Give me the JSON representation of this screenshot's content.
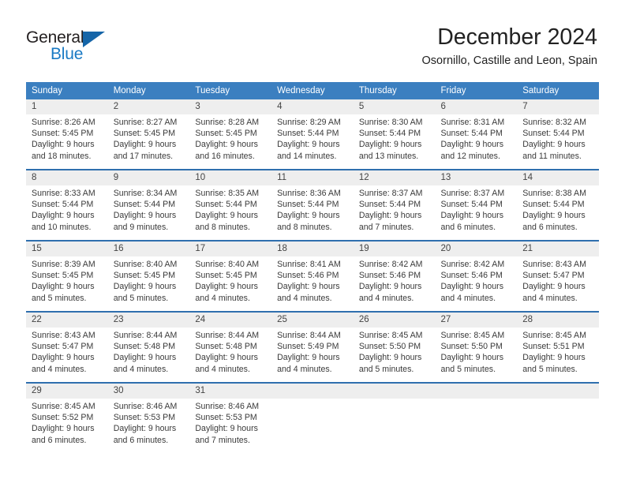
{
  "logo": {
    "word_one": "General",
    "word_two": "Blue",
    "triangle_color": "#1565a8",
    "blue_color": "#1a7ac4"
  },
  "header": {
    "month_title": "December 2024",
    "location": "Osornillo, Castille and Leon, Spain"
  },
  "calendar": {
    "header_color": "#3b7fc0",
    "row_divider_color": "#2f6fae",
    "daynum_band_color": "#eeeeee",
    "weekday_headers": [
      "Sunday",
      "Monday",
      "Tuesday",
      "Wednesday",
      "Thursday",
      "Friday",
      "Saturday"
    ],
    "weeks": [
      [
        {
          "day": "1",
          "sunrise": "Sunrise: 8:26 AM",
          "sunset": "Sunset: 5:45 PM",
          "daylight_line1": "Daylight: 9 hours",
          "daylight_line2": "and 18 minutes."
        },
        {
          "day": "2",
          "sunrise": "Sunrise: 8:27 AM",
          "sunset": "Sunset: 5:45 PM",
          "daylight_line1": "Daylight: 9 hours",
          "daylight_line2": "and 17 minutes."
        },
        {
          "day": "3",
          "sunrise": "Sunrise: 8:28 AM",
          "sunset": "Sunset: 5:45 PM",
          "daylight_line1": "Daylight: 9 hours",
          "daylight_line2": "and 16 minutes."
        },
        {
          "day": "4",
          "sunrise": "Sunrise: 8:29 AM",
          "sunset": "Sunset: 5:44 PM",
          "daylight_line1": "Daylight: 9 hours",
          "daylight_line2": "and 14 minutes."
        },
        {
          "day": "5",
          "sunrise": "Sunrise: 8:30 AM",
          "sunset": "Sunset: 5:44 PM",
          "daylight_line1": "Daylight: 9 hours",
          "daylight_line2": "and 13 minutes."
        },
        {
          "day": "6",
          "sunrise": "Sunrise: 8:31 AM",
          "sunset": "Sunset: 5:44 PM",
          "daylight_line1": "Daylight: 9 hours",
          "daylight_line2": "and 12 minutes."
        },
        {
          "day": "7",
          "sunrise": "Sunrise: 8:32 AM",
          "sunset": "Sunset: 5:44 PM",
          "daylight_line1": "Daylight: 9 hours",
          "daylight_line2": "and 11 minutes."
        }
      ],
      [
        {
          "day": "8",
          "sunrise": "Sunrise: 8:33 AM",
          "sunset": "Sunset: 5:44 PM",
          "daylight_line1": "Daylight: 9 hours",
          "daylight_line2": "and 10 minutes."
        },
        {
          "day": "9",
          "sunrise": "Sunrise: 8:34 AM",
          "sunset": "Sunset: 5:44 PM",
          "daylight_line1": "Daylight: 9 hours",
          "daylight_line2": "and 9 minutes."
        },
        {
          "day": "10",
          "sunrise": "Sunrise: 8:35 AM",
          "sunset": "Sunset: 5:44 PM",
          "daylight_line1": "Daylight: 9 hours",
          "daylight_line2": "and 8 minutes."
        },
        {
          "day": "11",
          "sunrise": "Sunrise: 8:36 AM",
          "sunset": "Sunset: 5:44 PM",
          "daylight_line1": "Daylight: 9 hours",
          "daylight_line2": "and 8 minutes."
        },
        {
          "day": "12",
          "sunrise": "Sunrise: 8:37 AM",
          "sunset": "Sunset: 5:44 PM",
          "daylight_line1": "Daylight: 9 hours",
          "daylight_line2": "and 7 minutes."
        },
        {
          "day": "13",
          "sunrise": "Sunrise: 8:37 AM",
          "sunset": "Sunset: 5:44 PM",
          "daylight_line1": "Daylight: 9 hours",
          "daylight_line2": "and 6 minutes."
        },
        {
          "day": "14",
          "sunrise": "Sunrise: 8:38 AM",
          "sunset": "Sunset: 5:44 PM",
          "daylight_line1": "Daylight: 9 hours",
          "daylight_line2": "and 6 minutes."
        }
      ],
      [
        {
          "day": "15",
          "sunrise": "Sunrise: 8:39 AM",
          "sunset": "Sunset: 5:45 PM",
          "daylight_line1": "Daylight: 9 hours",
          "daylight_line2": "and 5 minutes."
        },
        {
          "day": "16",
          "sunrise": "Sunrise: 8:40 AM",
          "sunset": "Sunset: 5:45 PM",
          "daylight_line1": "Daylight: 9 hours",
          "daylight_line2": "and 5 minutes."
        },
        {
          "day": "17",
          "sunrise": "Sunrise: 8:40 AM",
          "sunset": "Sunset: 5:45 PM",
          "daylight_line1": "Daylight: 9 hours",
          "daylight_line2": "and 4 minutes."
        },
        {
          "day": "18",
          "sunrise": "Sunrise: 8:41 AM",
          "sunset": "Sunset: 5:46 PM",
          "daylight_line1": "Daylight: 9 hours",
          "daylight_line2": "and 4 minutes."
        },
        {
          "day": "19",
          "sunrise": "Sunrise: 8:42 AM",
          "sunset": "Sunset: 5:46 PM",
          "daylight_line1": "Daylight: 9 hours",
          "daylight_line2": "and 4 minutes."
        },
        {
          "day": "20",
          "sunrise": "Sunrise: 8:42 AM",
          "sunset": "Sunset: 5:46 PM",
          "daylight_line1": "Daylight: 9 hours",
          "daylight_line2": "and 4 minutes."
        },
        {
          "day": "21",
          "sunrise": "Sunrise: 8:43 AM",
          "sunset": "Sunset: 5:47 PM",
          "daylight_line1": "Daylight: 9 hours",
          "daylight_line2": "and 4 minutes."
        }
      ],
      [
        {
          "day": "22",
          "sunrise": "Sunrise: 8:43 AM",
          "sunset": "Sunset: 5:47 PM",
          "daylight_line1": "Daylight: 9 hours",
          "daylight_line2": "and 4 minutes."
        },
        {
          "day": "23",
          "sunrise": "Sunrise: 8:44 AM",
          "sunset": "Sunset: 5:48 PM",
          "daylight_line1": "Daylight: 9 hours",
          "daylight_line2": "and 4 minutes."
        },
        {
          "day": "24",
          "sunrise": "Sunrise: 8:44 AM",
          "sunset": "Sunset: 5:48 PM",
          "daylight_line1": "Daylight: 9 hours",
          "daylight_line2": "and 4 minutes."
        },
        {
          "day": "25",
          "sunrise": "Sunrise: 8:44 AM",
          "sunset": "Sunset: 5:49 PM",
          "daylight_line1": "Daylight: 9 hours",
          "daylight_line2": "and 4 minutes."
        },
        {
          "day": "26",
          "sunrise": "Sunrise: 8:45 AM",
          "sunset": "Sunset: 5:50 PM",
          "daylight_line1": "Daylight: 9 hours",
          "daylight_line2": "and 5 minutes."
        },
        {
          "day": "27",
          "sunrise": "Sunrise: 8:45 AM",
          "sunset": "Sunset: 5:50 PM",
          "daylight_line1": "Daylight: 9 hours",
          "daylight_line2": "and 5 minutes."
        },
        {
          "day": "28",
          "sunrise": "Sunrise: 8:45 AM",
          "sunset": "Sunset: 5:51 PM",
          "daylight_line1": "Daylight: 9 hours",
          "daylight_line2": "and 5 minutes."
        }
      ],
      [
        {
          "day": "29",
          "sunrise": "Sunrise: 8:45 AM",
          "sunset": "Sunset: 5:52 PM",
          "daylight_line1": "Daylight: 9 hours",
          "daylight_line2": "and 6 minutes."
        },
        {
          "day": "30",
          "sunrise": "Sunrise: 8:46 AM",
          "sunset": "Sunset: 5:53 PM",
          "daylight_line1": "Daylight: 9 hours",
          "daylight_line2": "and 6 minutes."
        },
        {
          "day": "31",
          "sunrise": "Sunrise: 8:46 AM",
          "sunset": "Sunset: 5:53 PM",
          "daylight_line1": "Daylight: 9 hours",
          "daylight_line2": "and 7 minutes."
        },
        {
          "day": "",
          "sunrise": "",
          "sunset": "",
          "daylight_line1": "",
          "daylight_line2": ""
        },
        {
          "day": "",
          "sunrise": "",
          "sunset": "",
          "daylight_line1": "",
          "daylight_line2": ""
        },
        {
          "day": "",
          "sunrise": "",
          "sunset": "",
          "daylight_line1": "",
          "daylight_line2": ""
        },
        {
          "day": "",
          "sunrise": "",
          "sunset": "",
          "daylight_line1": "",
          "daylight_line2": ""
        }
      ]
    ]
  }
}
